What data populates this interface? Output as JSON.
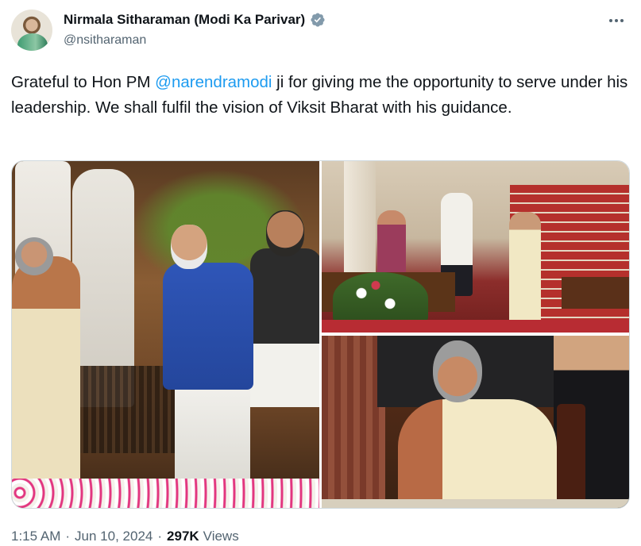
{
  "author": {
    "display_name": "Nirmala Sitharaman (Modi Ka Parivar)",
    "handle": "@nsitharaman",
    "verified": true,
    "avatar_icon": "profile-photo"
  },
  "tweet": {
    "text_before_mention": "Grateful to Hon PM ",
    "mention": "@narendramodi",
    "text_after_mention": " ji for giving me the opportunity to serve under his leadership. We shall fulfil the vision of Viksit Bharat with his guidance."
  },
  "media": {
    "count": 3,
    "photos": [
      "photo-greeting",
      "photo-ceremony-hall",
      "photo-signing"
    ]
  },
  "meta": {
    "time": "1:15 AM",
    "date": "Jun 10, 2024",
    "views_count": "297K",
    "views_label": "Views",
    "separator": "·"
  },
  "colors": {
    "link": "#1d9bf0",
    "verified_badge": "#829aab",
    "secondary_text": "#536471"
  },
  "icons": {
    "more": "more-dots-icon",
    "verified": "verified-badge-icon"
  }
}
